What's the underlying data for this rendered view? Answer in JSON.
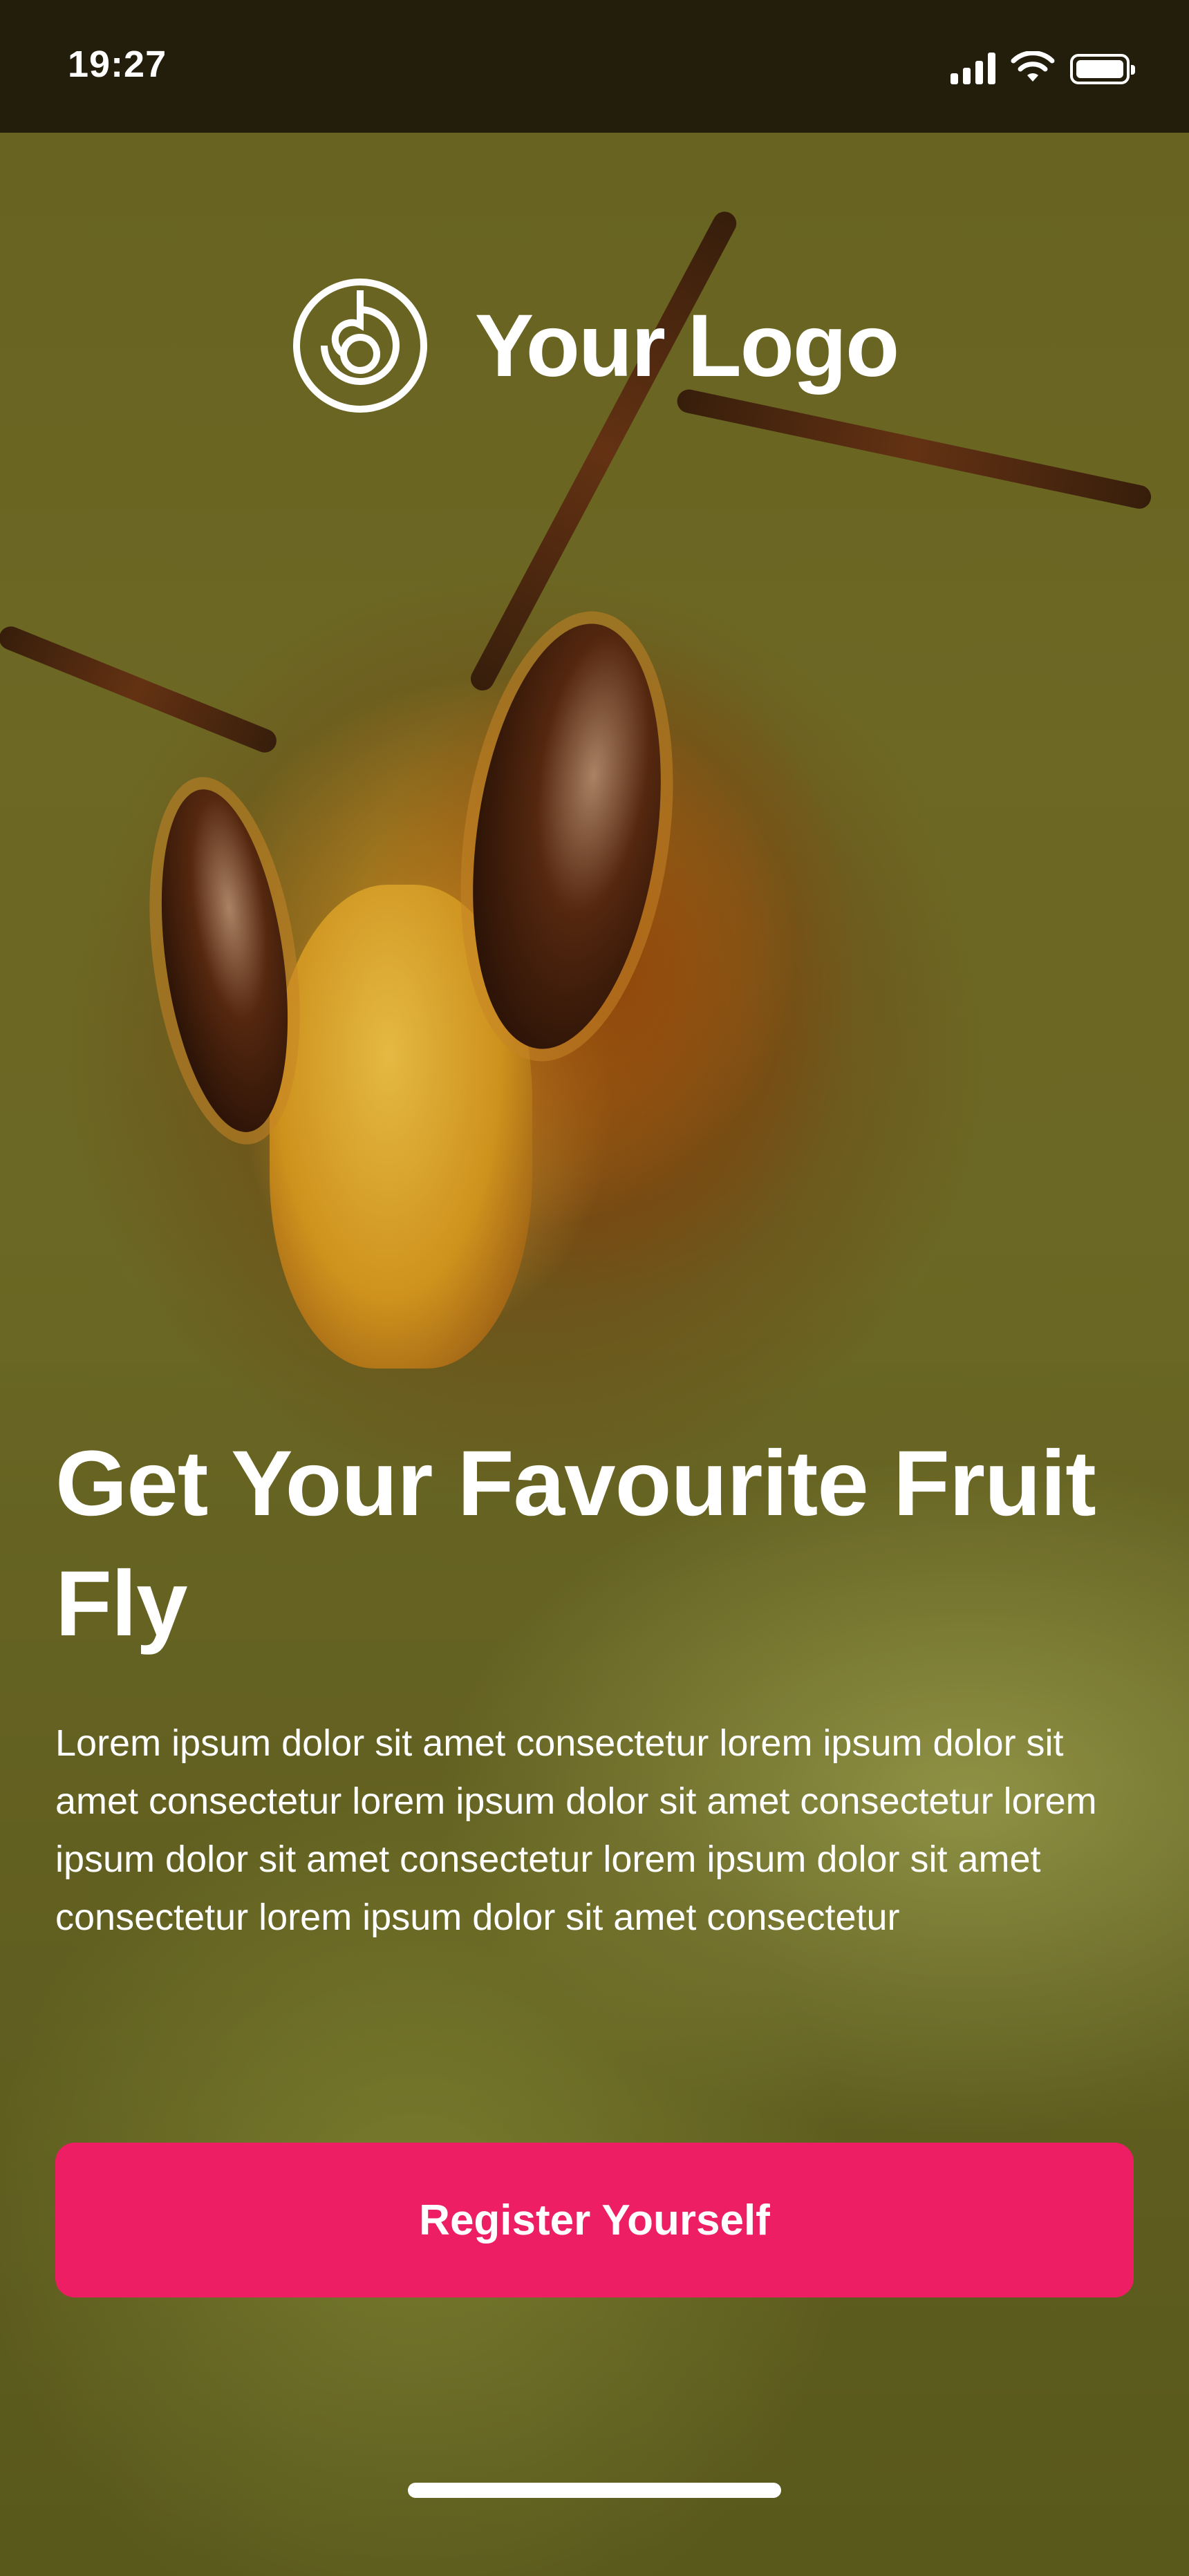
{
  "status_bar": {
    "time": "19:27",
    "icons": [
      "signal-icon",
      "wifi-icon",
      "battery-icon"
    ]
  },
  "logo": {
    "icon": "spiral-logo-icon",
    "text": "Your Logo"
  },
  "hero": {
    "image": "hornet-close-up-photo",
    "headline": "Get Your Favourite Fruit Fly",
    "description": "Lorem ipsum dolor sit amet consectetur lorem ipsum dolor sit amet consectetur lorem ipsum dolor sit amet consectetur lorem ipsum dolor sit amet consectetur lorem ipsum dolor sit amet consectetur lorem ipsum dolor sit amet consectetur"
  },
  "actions": {
    "register_label": "Register Yourself"
  },
  "colors": {
    "status_bar_bg": "#231d0c",
    "primary_button": "#ee1e64",
    "text": "#ffffff"
  }
}
